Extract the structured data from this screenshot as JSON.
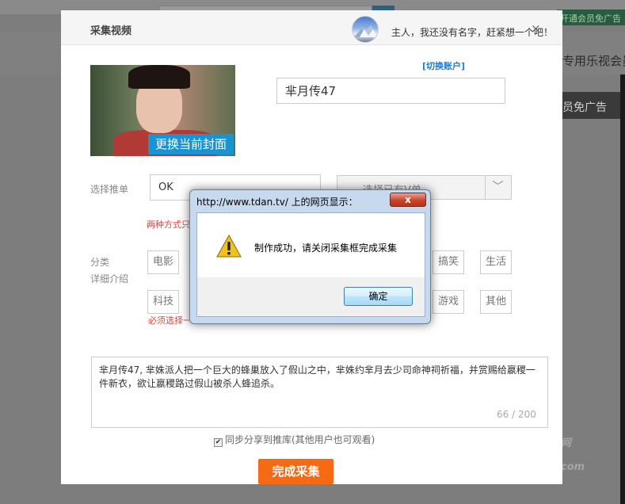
{
  "background": {
    "vip_text": "开通会员免广告",
    "side_text_1": "专用乐视会员",
    "side_text_2": "员免广告",
    "watermark_1": "网",
    "watermark_2": "com"
  },
  "modal": {
    "title": "采集视频",
    "user_message": "主人，我还没有名字，赶紧想一个吧！",
    "close_icon": "×",
    "switch_account": "[切换账户]",
    "cover_button": "更换当前封面",
    "video_name": "芈月传47",
    "recommend_label": "选择推单",
    "recommend_value": "OK",
    "vlist_placeholder": "选择已有V单",
    "vlist_arrow": "﹀",
    "recommend_hint": "两种方式只",
    "category_label_1": "分类",
    "category_label_2": "详细介绍",
    "category_hint": "必须选择一",
    "tags": [
      "电影",
      "搞笑",
      "生活",
      "科技",
      "游戏",
      "其他"
    ],
    "description": "芈月传47, 芈姝派人把一个巨大的蜂巢放入了假山之中，芈姝约芈月去少司命神祠祈福，并赏赐给嬴稷一件新衣，欲让嬴稷路过假山被杀人蜂追杀。",
    "char_count": "66 / 200",
    "share_checkbox": "✔",
    "share_label": "同步分享到推库(其他用户也可观看)",
    "finish_button": "完成采集"
  },
  "alert": {
    "title": "http://www.tdan.tv/ 上的网页显示：",
    "close_label": "x",
    "message": "制作成功，请关闭采集框完成采集",
    "ok_button": "确定"
  }
}
